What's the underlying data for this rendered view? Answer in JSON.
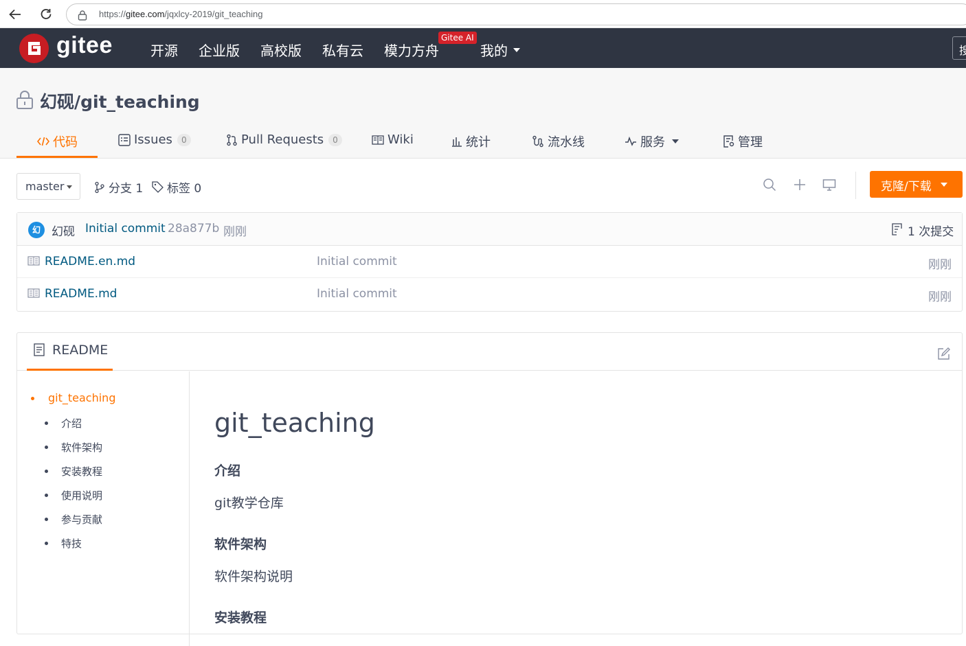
{
  "browser": {
    "url_prefix": "https://",
    "url_host": "gitee.com",
    "url_path": "/jqxlcy-2019/git_teaching"
  },
  "header": {
    "logo_text": "gitee",
    "nav": [
      "开源",
      "企业版",
      "高校版",
      "私有云",
      "模力方舟",
      "我的"
    ],
    "ai_badge": "Gitee AI",
    "edge_text": "搜"
  },
  "repo": {
    "title": "幻砚/git_teaching",
    "tabs": {
      "code": "代码",
      "issues": "Issues",
      "issues_count": "0",
      "pulls": "Pull Requests",
      "pulls_count": "0",
      "wiki": "Wiki",
      "stats": "统计",
      "pipeline": "流水线",
      "services": "服务",
      "manage": "管理"
    }
  },
  "toolbar": {
    "branch": "master",
    "branches": "分支 1",
    "tags": "标签 0",
    "clone_label": "克隆/下载"
  },
  "commit": {
    "avatar_char": "幻",
    "author": "幻砚",
    "message": "Initial commit",
    "hash": "28a877b",
    "time": "刚刚",
    "count": "1 次提交"
  },
  "files": [
    {
      "name": "README.en.md",
      "message": "Initial commit",
      "time": "刚刚"
    },
    {
      "name": "README.md",
      "message": "Initial commit",
      "time": "刚刚"
    }
  ],
  "readme": {
    "tab_label": "README",
    "toc": [
      "git_teaching",
      "介绍",
      "软件架构",
      "安装教程",
      "使用说明",
      "参与贡献",
      "特技"
    ],
    "h1": "git_teaching",
    "sections": [
      {
        "heading": "介绍",
        "text": "git教学仓库"
      },
      {
        "heading": "软件架构",
        "text": "软件架构说明"
      },
      {
        "heading": "安装教程"
      }
    ]
  },
  "colors": {
    "accent": "#fe7300",
    "header_bg": "#2f3542",
    "link": "#005980",
    "logo_red": "#c71d23"
  }
}
